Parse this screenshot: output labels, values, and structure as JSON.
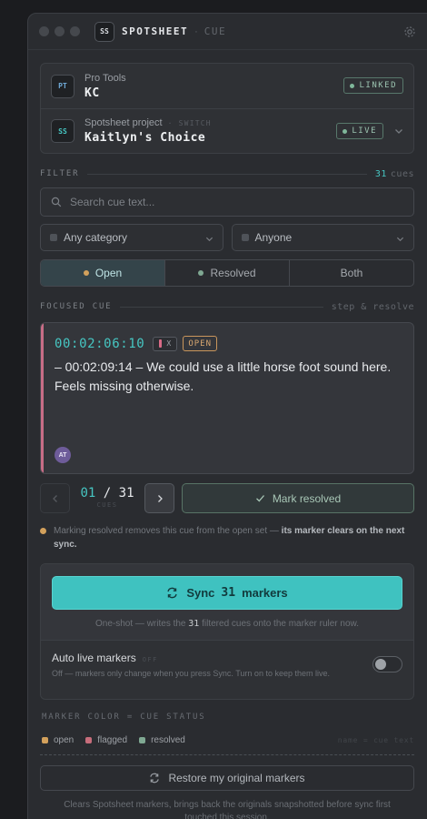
{
  "window": {
    "logo": "SS",
    "app_name": "SPOTSHEET",
    "separator": "·",
    "subtitle": "CUE"
  },
  "connections": {
    "protools": {
      "badge": "PT",
      "kicker": "Pro Tools",
      "name": "KC",
      "status": "LINKED"
    },
    "project": {
      "badge": "SS",
      "kicker": "Spotsheet project",
      "switch_label": "· SWITCH",
      "name": "Kaitlyn's Choice",
      "status": "LIVE"
    }
  },
  "filter": {
    "label": "FILTER",
    "count": "31",
    "count_unit": "cues",
    "search_placeholder": "Search cue text...",
    "category_select": "Any category",
    "person_select": "Anyone",
    "segments": [
      {
        "label": "Open",
        "dot_color": "#d3a15c",
        "active": true
      },
      {
        "label": "Resolved",
        "dot_color": "#7fa892",
        "active": false
      },
      {
        "label": "Both",
        "active": false
      }
    ]
  },
  "focused": {
    "label": "FOCUSED CUE",
    "right_label": "step & resolve",
    "timecode": "00:02:06:10",
    "category": "X",
    "status": "OPEN",
    "text": "– 00:02:09:14 – We could use a little horse foot sound here. Feels missing otherwise.",
    "avatar": "AT",
    "accent_color": "#c76d86"
  },
  "stepper": {
    "current": "01",
    "divider": "/",
    "total": "31",
    "unit": "CUES",
    "resolve_label": "Mark resolved"
  },
  "hint": {
    "text": "Marking resolved removes this cue from the open set — ",
    "emphasis": "its marker clears on the next sync."
  },
  "sync": {
    "prefix": "Sync",
    "count": "31",
    "suffix": "markers",
    "note_prefix": "One-shot — writes the",
    "note_count": "31",
    "note_suffix": "filtered cues onto the marker ruler now.",
    "auto_title": "Auto live markers",
    "auto_state": "OFF",
    "auto_desc": "Off — markers only change when you press Sync. Turn on to keep them live."
  },
  "legend": {
    "label": "MARKER COLOR = CUE STATUS",
    "items": [
      {
        "label": "open",
        "color": "#d3a15c"
      },
      {
        "label": "flagged",
        "color": "#c76d7b"
      },
      {
        "label": "resolved",
        "color": "#7fa892"
      }
    ],
    "right": "name = cue text"
  },
  "restore": {
    "label": "Restore my original markers",
    "note": "Clears Spotsheet markers, brings back the originals snapshotted before sync first touched this session."
  }
}
